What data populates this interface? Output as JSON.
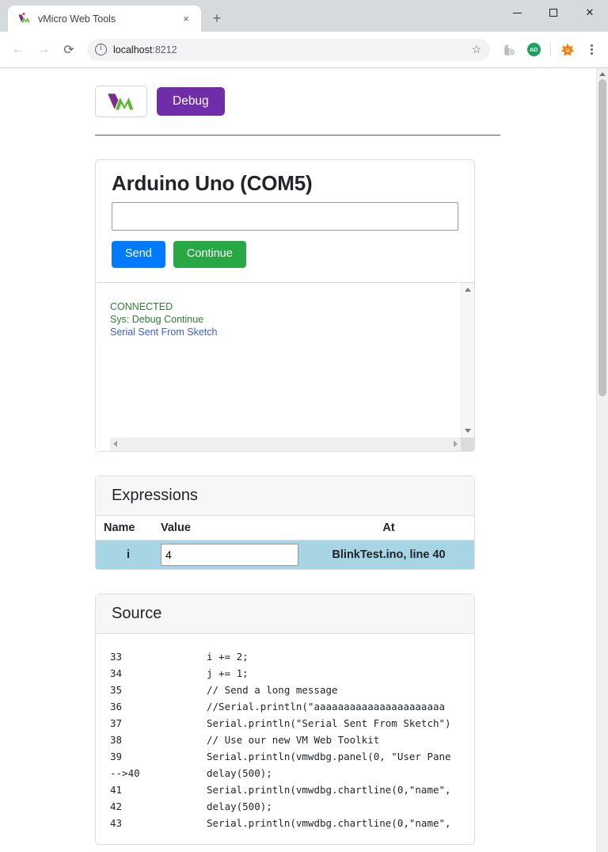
{
  "browser": {
    "tab": {
      "title": "vMicro Web Tools",
      "favicon": "vmicro-logo-icon",
      "close": "×"
    },
    "newtab_label": "+",
    "window": {
      "minimize": "–",
      "maximize": "□",
      "close": "✕"
    },
    "nav": {
      "back": "←",
      "forward": "→",
      "reload": "⟳"
    },
    "omnibox": {
      "host": "localhost",
      "port": ":8212",
      "star": "☆",
      "info_icon": "site-info-icon"
    },
    "extensions": [
      {
        "name": "extension-icon",
        "label": ""
      },
      {
        "name": "adblock-icon",
        "label": "AD"
      },
      {
        "name": "avast-icon",
        "label": ""
      }
    ],
    "menu": "chrome-menu-icon"
  },
  "page": {
    "header": {
      "logo_alt": "vMicro VM logo",
      "debug_button": "Debug"
    },
    "serial_card": {
      "title": "Arduino Uno (COM5)",
      "input_value": "",
      "input_placeholder": "",
      "send_label": "Send",
      "continue_label": "Continue",
      "console_lines": [
        {
          "text": "CONNECTED",
          "color": "green"
        },
        {
          "text": "Sys: Debug Continue",
          "color": "green"
        },
        {
          "text": "Serial Sent From Sketch",
          "color": "blue"
        }
      ]
    },
    "expressions_card": {
      "title": "Expressions",
      "columns": [
        "Name",
        "Value",
        "At"
      ],
      "rows": [
        {
          "name": "i",
          "value": "4",
          "at": "BlinkTest.ino, line 40"
        }
      ],
      "row_highlight_color": "#a8d5e4"
    },
    "source_card": {
      "title": "Source",
      "current_marker": "-->",
      "lines": [
        {
          "num": "33",
          "code": "i += 2;"
        },
        {
          "num": "34",
          "code": "j += 1;"
        },
        {
          "num": "35",
          "code": "// Send a long message"
        },
        {
          "num": "36",
          "code": "//Serial.println(\"aaaaaaaaaaaaaaaaaaaaaa"
        },
        {
          "num": "37",
          "code": "Serial.println(\"Serial Sent From Sketch\")"
        },
        {
          "num": "38",
          "code": "// Use our new VM Web Toolkit"
        },
        {
          "num": "39",
          "code": "Serial.println(vmwdbg.panel(0, \"User Pane"
        },
        {
          "num": "-->40",
          "code": "delay(500);"
        },
        {
          "num": "41",
          "code": "Serial.println(vmwdbg.chartline(0,\"name\","
        },
        {
          "num": "42",
          "code": "delay(500);"
        },
        {
          "num": "43",
          "code": "Serial.println(vmwdbg.chartline(0,\"name\","
        }
      ]
    }
  },
  "colors": {
    "brand_purple": "#6f2da8",
    "send_blue": "#007bff",
    "continue_green": "#28a745",
    "console_green": "#2e7d32",
    "console_blue": "#3b5bdb"
  }
}
